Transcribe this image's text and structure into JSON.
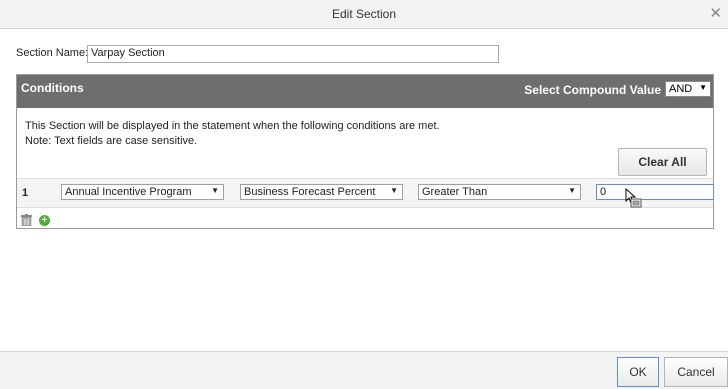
{
  "dialog": {
    "title": "Edit Section",
    "close_icon": "close-icon"
  },
  "section_name": {
    "label": "Section Name:",
    "value": "Varpay Section"
  },
  "conditions": {
    "title": "Conditions",
    "compound_label": "Select Compound Value",
    "compound_value": "AND",
    "info_line1": "This Section will be displayed in the statement when the following conditions are met.",
    "info_line2": "Note: Text fields are case sensitive.",
    "clear_all_label": "Clear All",
    "rows": [
      {
        "number": "1",
        "program": "Annual Incentive Program",
        "field": "Business Forecast Percent",
        "operator": "Greater Than",
        "value": "0"
      }
    ]
  },
  "footer": {
    "ok_label": "OK",
    "cancel_label": "Cancel"
  },
  "colors": {
    "header_bg": "#6e6e6e",
    "focus_border": "#5b8fd6",
    "add_green": "#4cae3b"
  }
}
